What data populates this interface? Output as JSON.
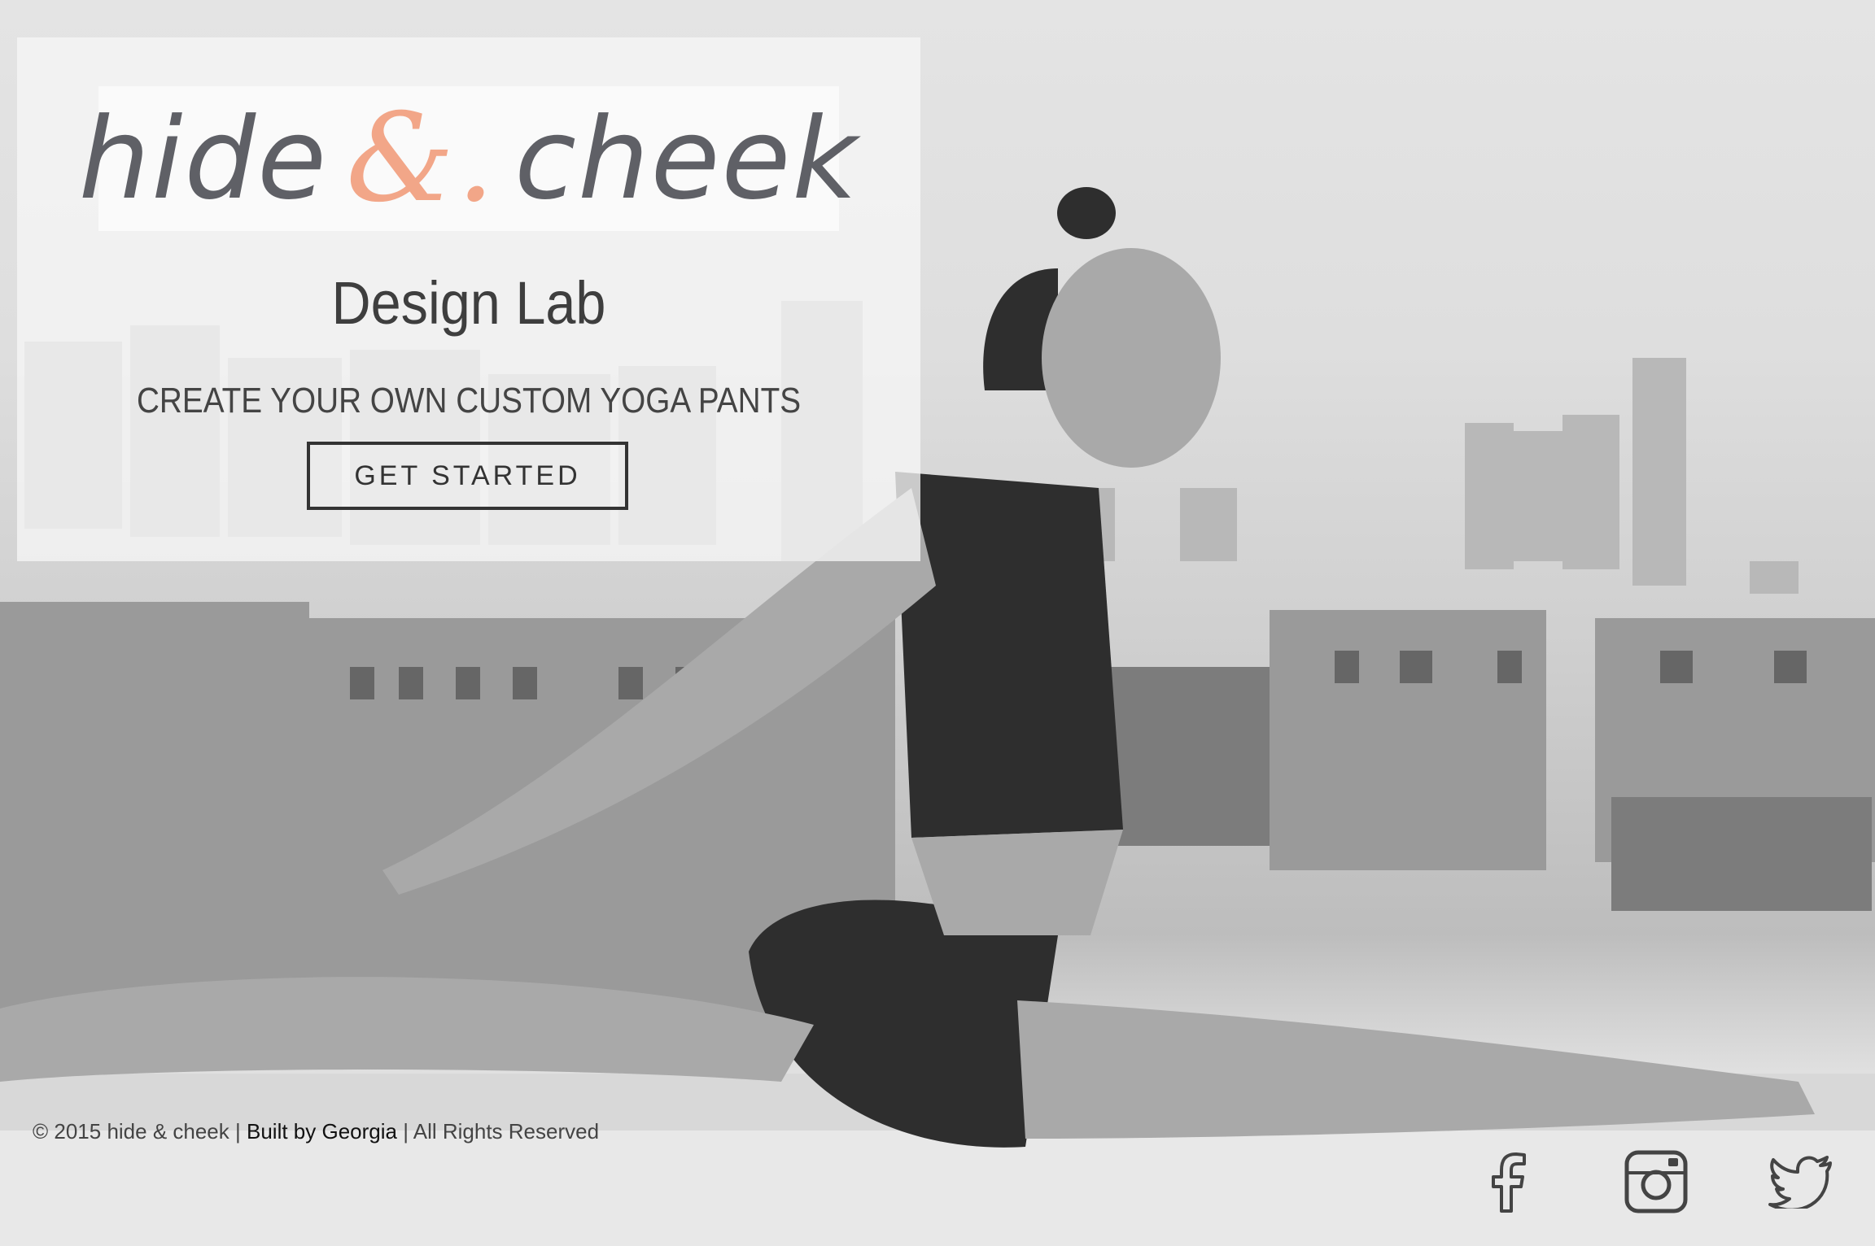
{
  "brand": {
    "logo_left": "hide",
    "logo_amp": "&.",
    "logo_right": "cheek"
  },
  "hero": {
    "subtitle": "Design Lab",
    "tagline": "CREATE YOUR OWN CUSTOM YOGA PANTS",
    "cta_label": "GET STARTED"
  },
  "footer": {
    "copyright": "© 2015 hide & cheek | ",
    "credit": "Built by Georgia",
    "rights": " | All Rights Reserved"
  },
  "social": [
    {
      "icon": "facebook-icon"
    },
    {
      "icon": "instagram-icon"
    },
    {
      "icon": "twitter-icon"
    }
  ],
  "colors": {
    "accent": "#f2a688",
    "logo_text": "#5f6066",
    "text": "#3e3e3e"
  }
}
